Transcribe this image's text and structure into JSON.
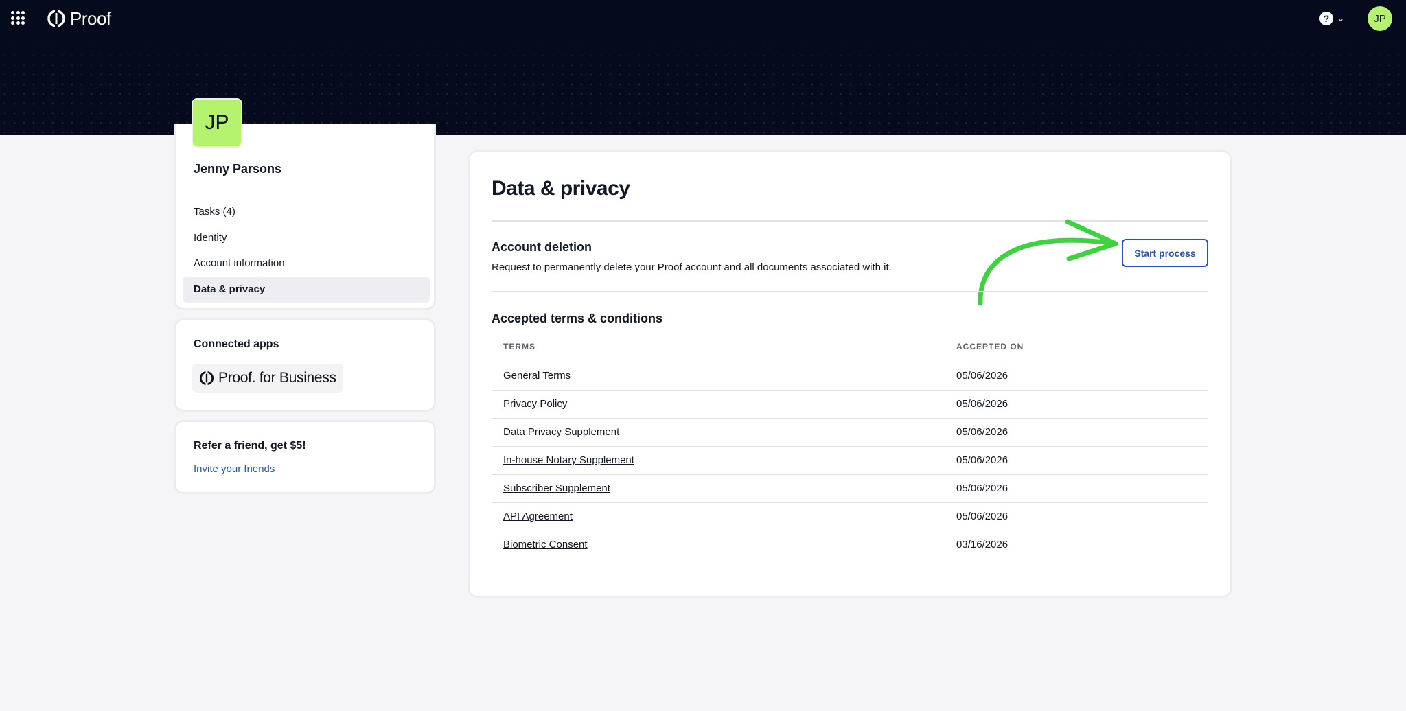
{
  "header": {
    "logo_text": "Proof",
    "help_icon_text": "?",
    "user_initials": "JP"
  },
  "profile": {
    "initials": "JP",
    "name": "Jenny Parsons"
  },
  "nav": {
    "items": [
      {
        "label": "Tasks (4)",
        "active": false
      },
      {
        "label": "Identity",
        "active": false
      },
      {
        "label": "Account information",
        "active": false
      },
      {
        "label": "Data & privacy",
        "active": true
      }
    ]
  },
  "connected_apps": {
    "title": "Connected apps",
    "app_text": "Proof. for Business"
  },
  "referral": {
    "title": "Refer a friend, get $5!",
    "link": "Invite your friends"
  },
  "main": {
    "title": "Data & privacy",
    "deletion_title": "Account deletion",
    "deletion_desc": "Request to permanently delete your Proof account and all documents associated with it.",
    "start_button": "Start process",
    "terms_title": "Accepted terms & conditions",
    "col_terms": "TERMS",
    "col_accepted": "ACCEPTED ON",
    "terms": [
      {
        "name": "General Terms",
        "date": "05/06/2026"
      },
      {
        "name": "Privacy Policy",
        "date": "05/06/2026"
      },
      {
        "name": "Data Privacy Supplement",
        "date": "05/06/2026"
      },
      {
        "name": "In-house Notary Supplement",
        "date": "05/06/2026"
      },
      {
        "name": "Subscriber Supplement",
        "date": "05/06/2026"
      },
      {
        "name": "API Agreement",
        "date": "05/06/2026"
      },
      {
        "name": "Biometric Consent",
        "date": "03/16/2026"
      }
    ]
  },
  "colors": {
    "accent": "#2252cf",
    "avatar": "#b5f26d",
    "header_bg": "#050a1c",
    "annotation_arrow": "#3fd23f"
  }
}
